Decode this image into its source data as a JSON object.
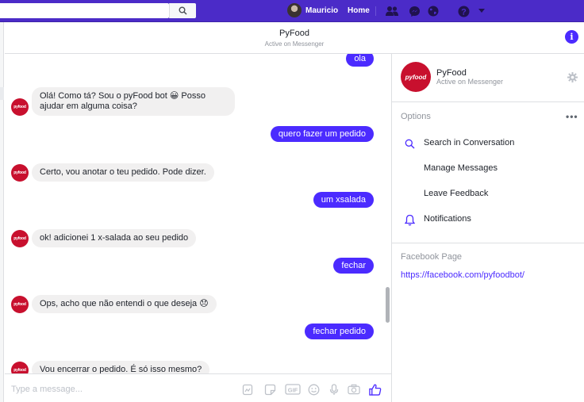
{
  "topbar": {
    "user_name": "Mauricio",
    "home_label": "Home",
    "icons": [
      "search-icon",
      "friends-icon",
      "messenger-icon",
      "globe-icon",
      "help-icon",
      "dropdown-icon"
    ]
  },
  "conversation": {
    "title": "PyFood",
    "status": "Active on Messenger"
  },
  "bot": {
    "avatar_text": "pyfood"
  },
  "messages": [
    {
      "from": "user",
      "text": "ola"
    },
    {
      "from": "bot",
      "text": "Olá! Como tá? Sou o pyFood bot 😀 Posso ajudar em alguma coisa?"
    },
    {
      "from": "user",
      "text": "quero fazer um pedido"
    },
    {
      "from": "bot",
      "text": "Certo, vou anotar o teu pedido. Pode dizer."
    },
    {
      "from": "user",
      "text": "um xsalada"
    },
    {
      "from": "bot",
      "text": "ok! adicionei 1 x-salada ao seu pedido"
    },
    {
      "from": "user",
      "text": "fechar"
    },
    {
      "from": "bot",
      "text": "Ops, acho que não entendi o que deseja 😞"
    },
    {
      "from": "user",
      "text": "fechar pedido"
    },
    {
      "from": "bot",
      "text": "Vou encerrar o pedido. É só isso mesmo?"
    }
  ],
  "composer": {
    "placeholder": "Type a message...",
    "icons": [
      "file-icon",
      "sticker-icon",
      "gif-icon",
      "emoji-icon",
      "microphone-icon",
      "camera-icon",
      "like-icon"
    ]
  },
  "right_panel": {
    "name": "PyFood",
    "status": "Active on Messenger",
    "options_title": "Options",
    "options": [
      {
        "label": "Search in Conversation",
        "icon": "search-icon"
      },
      {
        "label": "Manage Messages",
        "icon": ""
      },
      {
        "label": "Leave Feedback",
        "icon": ""
      },
      {
        "label": "Notifications",
        "icon": "bell-icon"
      }
    ],
    "facebook_page_title": "Facebook Page",
    "facebook_page_link": "https://facebook.com/pyfoodbot/"
  },
  "colors": {
    "brand": "#4b2bc8",
    "accent": "#4b2bff",
    "bot_avatar": "#c8102e",
    "incoming_bubble": "#f1f0f0"
  }
}
